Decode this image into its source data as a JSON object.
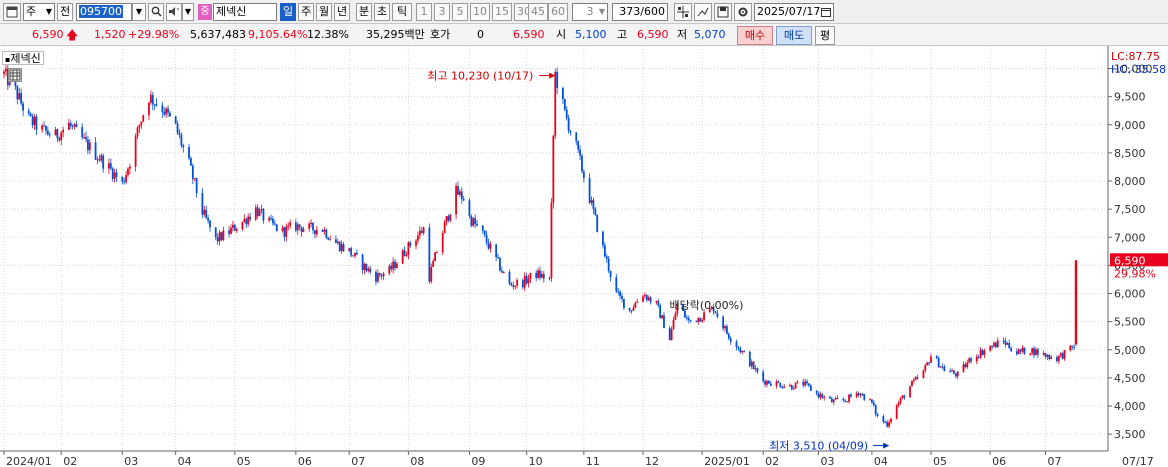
{
  "toolbar": {
    "market": "주",
    "mode": "전",
    "code": "095700",
    "tag": "중",
    "name": "제넥신",
    "periods": [
      "일",
      "주",
      "월",
      "년",
      "분",
      "초",
      "틱"
    ],
    "active_period": "일",
    "numbers": [
      "1",
      "3",
      "5",
      "10",
      "15",
      "30",
      "45",
      "60"
    ],
    "count_select": "3",
    "range": "373/600",
    "date": "2025/07/17"
  },
  "quote": {
    "price": "6,590",
    "change": "1,520",
    "change_pct": "+29.98%",
    "volume": "5,637,483",
    "volume_pct": "9,105.64%",
    "turnover": "12.38%",
    "amount": "35,295백만",
    "hoga_label": "호가",
    "hoga_value": "0",
    "ask": "6,590",
    "open_label": "시",
    "open": "5,100",
    "high_label": "고",
    "high": "6,590",
    "low_label": "저",
    "low": "5,070",
    "buy_label": "매수",
    "sell_label": "매도",
    "avg_label": "평"
  },
  "colors": {
    "up": "#e8001c",
    "down": "#0050d8",
    "toolbar_bg": "#f0f0f0",
    "active_tab": "#1a5fc8"
  },
  "chart_data": {
    "type": "candlestick",
    "stock_label": "제넥신",
    "ylim": [
      3200,
      10400
    ],
    "y_ticks": [
      3500,
      4000,
      4500,
      5000,
      5500,
      6000,
      6500,
      7000,
      7500,
      8000,
      8500,
      9000,
      9500,
      10000
    ],
    "y_tick_labels": [
      "3,500",
      "4,000",
      "4,500",
      "5,000",
      "5,500",
      "6,000",
      "6,500",
      "7,000",
      "7,500",
      "8,000",
      "8,500",
      "9,000",
      "9,500",
      "10,000"
    ],
    "x_labels": [
      {
        "label": "2024/01",
        "date": "2024-01-02"
      },
      {
        "label": "02",
        "date": "2024-02-01"
      },
      {
        "label": "03",
        "date": "2024-03-04"
      },
      {
        "label": "04",
        "date": "2024-04-01"
      },
      {
        "label": "05",
        "date": "2024-05-02"
      },
      {
        "label": "06",
        "date": "2024-06-03"
      },
      {
        "label": "07",
        "date": "2024-07-01"
      },
      {
        "label": "08",
        "date": "2024-08-01"
      },
      {
        "label": "09",
        "date": "2024-09-02"
      },
      {
        "label": "10",
        "date": "2024-10-02"
      },
      {
        "label": "11",
        "date": "2024-11-01"
      },
      {
        "label": "12",
        "date": "2024-12-02"
      },
      {
        "label": "2025/01",
        "date": "2025-01-02"
      },
      {
        "label": "02",
        "date": "2025-02-03"
      },
      {
        "label": "03",
        "date": "2025-03-04"
      },
      {
        "label": "04",
        "date": "2025-04-01"
      },
      {
        "label": "05",
        "date": "2025-05-02"
      },
      {
        "label": "06",
        "date": "2025-06-02"
      },
      {
        "label": "07",
        "date": "2025-07-01"
      },
      {
        "label": "07/17",
        "date": "2025-07-17"
      }
    ],
    "x_range": [
      "2024-01-02",
      "2025-07-17"
    ],
    "close_path": [
      [
        "2024-01-02",
        9900
      ],
      [
        "2024-01-08",
        9600
      ],
      [
        "2024-01-15",
        9100
      ],
      [
        "2024-01-22",
        8900
      ],
      [
        "2024-01-29",
        8800
      ],
      [
        "2024-02-05",
        9000
      ],
      [
        "2024-02-13",
        8700
      ],
      [
        "2024-02-20",
        8450
      ],
      [
        "2024-02-27",
        8200
      ],
      [
        "2024-03-04",
        7950
      ],
      [
        "2024-03-08",
        8350
      ],
      [
        "2024-03-13",
        9000
      ],
      [
        "2024-03-18",
        9500
      ],
      [
        "2024-03-25",
        9300
      ],
      [
        "2024-04-01",
        8950
      ],
      [
        "2024-04-08",
        8300
      ],
      [
        "2024-04-15",
        7450
      ],
      [
        "2024-04-22",
        6950
      ],
      [
        "2024-04-29",
        7100
      ],
      [
        "2024-05-07",
        7300
      ],
      [
        "2024-05-13",
        7500
      ],
      [
        "2024-05-20",
        7250
      ],
      [
        "2024-05-27",
        7100
      ],
      [
        "2024-06-03",
        7200
      ],
      [
        "2024-06-10",
        7150
      ],
      [
        "2024-06-17",
        7150
      ],
      [
        "2024-06-24",
        6900
      ],
      [
        "2024-07-01",
        6750
      ],
      [
        "2024-07-08",
        6500
      ],
      [
        "2024-07-15",
        6300
      ],
      [
        "2024-07-22",
        6400
      ],
      [
        "2024-07-29",
        6700
      ],
      [
        "2024-08-05",
        7000
      ],
      [
        "2024-08-09",
        7150
      ],
      [
        "2024-08-12",
        6300
      ],
      [
        "2024-08-19",
        7100
      ],
      [
        "2024-08-26",
        7800
      ],
      [
        "2024-08-30",
        7700
      ],
      [
        "2024-09-02",
        7350
      ],
      [
        "2024-09-09",
        7050
      ],
      [
        "2024-09-16",
        6600
      ],
      [
        "2024-09-23",
        6150
      ],
      [
        "2024-09-30",
        6200
      ],
      [
        "2024-10-07",
        6350
      ],
      [
        "2024-10-14",
        6250
      ],
      [
        "2024-10-16",
        8800
      ],
      [
        "2024-10-17",
        9900
      ],
      [
        "2024-10-22",
        9200
      ],
      [
        "2024-10-28",
        8600
      ],
      [
        "2024-11-04",
        7700
      ],
      [
        "2024-11-11",
        6800
      ],
      [
        "2024-11-18",
        6000
      ],
      [
        "2024-11-25",
        5700
      ],
      [
        "2024-12-02",
        6000
      ],
      [
        "2024-12-09",
        5800
      ],
      [
        "2024-12-16",
        5200
      ],
      [
        "2024-12-20",
        5800
      ],
      [
        "2024-12-26",
        5500
      ],
      [
        "2025-01-02",
        5600
      ],
      [
        "2025-01-08",
        5750
      ],
      [
        "2025-01-15",
        5300
      ],
      [
        "2025-01-22",
        5000
      ],
      [
        "2025-02-03",
        4450
      ],
      [
        "2025-02-10",
        4400
      ],
      [
        "2025-02-17",
        4350
      ],
      [
        "2025-02-24",
        4400
      ],
      [
        "2025-03-04",
        4200
      ],
      [
        "2025-03-11",
        4080
      ],
      [
        "2025-03-18",
        4100
      ],
      [
        "2025-03-25",
        4250
      ],
      [
        "2025-04-01",
        4050
      ],
      [
        "2025-04-04",
        3800
      ],
      [
        "2025-04-09",
        3680
      ],
      [
        "2025-04-14",
        4000
      ],
      [
        "2025-04-21",
        4350
      ],
      [
        "2025-04-28",
        4600
      ],
      [
        "2025-05-02",
        4900
      ],
      [
        "2025-05-09",
        4650
      ],
      [
        "2025-05-16",
        4550
      ],
      [
        "2025-05-23",
        4850
      ],
      [
        "2025-06-02",
        5050
      ],
      [
        "2025-06-09",
        5150
      ],
      [
        "2025-06-16",
        4950
      ],
      [
        "2025-06-23",
        5000
      ],
      [
        "2025-07-01",
        4900
      ],
      [
        "2025-07-07",
        4850
      ],
      [
        "2025-07-14",
        5000
      ],
      [
        "2025-07-16",
        5070
      ],
      [
        "2025-07-17",
        6590
      ]
    ],
    "last_candle": {
      "date": "2025-07-17",
      "open": 5100,
      "high": 6590,
      "low": 5070,
      "close": 6590
    },
    "annotations": {
      "high": {
        "text": "최고 10,230 (10/17)",
        "value": 10230,
        "date": "2024-10-17"
      },
      "low": {
        "text": "최저 3,510 (04/09)",
        "value": 3510,
        "date": "2025-04-09"
      },
      "note": {
        "text": "배당락(0.00%)",
        "value": 5900,
        "date": "2024-12-18"
      }
    },
    "right_labels": {
      "lc": "LC:87.75",
      "hc": "HC:-35.58"
    },
    "last_price_label": "6,590",
    "last_change_label": "29.98%"
  }
}
